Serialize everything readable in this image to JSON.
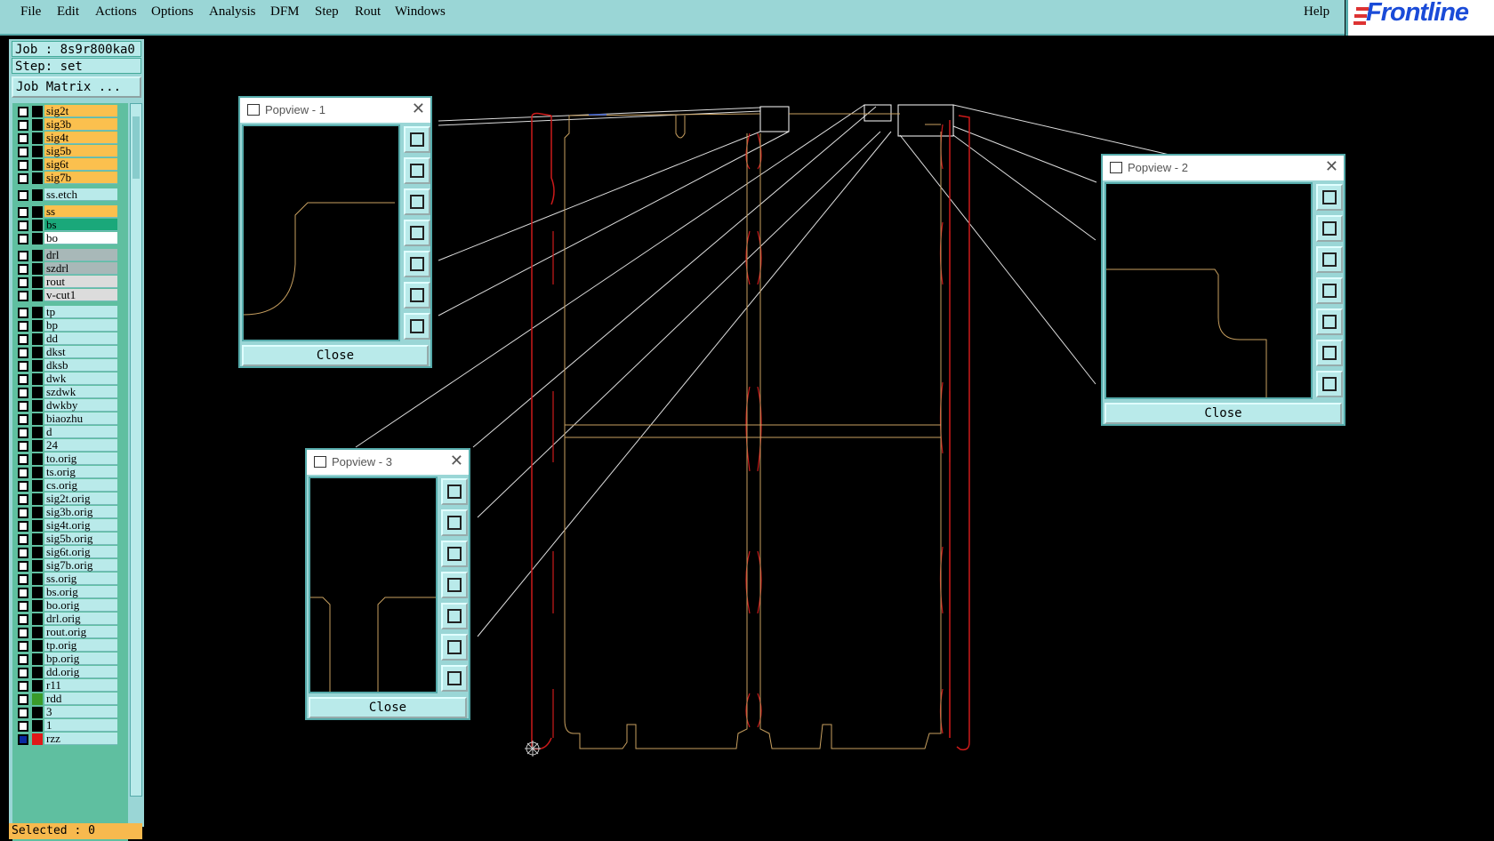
{
  "menubar": {
    "items": [
      "File",
      "Edit",
      "Actions",
      "Options",
      "Analysis",
      "DFM",
      "Step",
      "Rout",
      "Windows"
    ],
    "help": "Help",
    "logo": "Frontline"
  },
  "panel": {
    "job": "Job : 8s9r800ka0",
    "step": "Step: set",
    "job_matrix": "Job Matrix ...",
    "selected": "Selected : 0"
  },
  "layers": [
    {
      "name": "sig2t",
      "color": "#fbc04e"
    },
    {
      "name": "sig3b",
      "color": "#fbc04e"
    },
    {
      "name": "sig4t",
      "color": "#fbc04e"
    },
    {
      "name": "sig5b",
      "color": "#fbc04e"
    },
    {
      "name": "sig6t",
      "color": "#fbc04e"
    },
    {
      "name": "sig7b",
      "color": "#fbc04e"
    },
    {
      "name": "ss.etch",
      "color": "#b9eaea"
    },
    {
      "name": "ss",
      "color": "#fbc04e"
    },
    {
      "name": "bs",
      "color": "#1aa87a"
    },
    {
      "name": "bo",
      "color": "#ffffff"
    },
    {
      "name": "drl",
      "color": "#a8b8b8"
    },
    {
      "name": "szdrl",
      "color": "#a8b8b8"
    },
    {
      "name": "rout",
      "color": "#dcdcdc"
    },
    {
      "name": "v-cut1",
      "color": "#dcdcdc"
    },
    {
      "name": "tp",
      "color": "#b9eaea"
    },
    {
      "name": "bp",
      "color": "#b9eaea"
    },
    {
      "name": "dd",
      "color": "#b9eaea"
    },
    {
      "name": "dkst",
      "color": "#b9eaea"
    },
    {
      "name": "dksb",
      "color": "#b9eaea"
    },
    {
      "name": "dwk",
      "color": "#b9eaea"
    },
    {
      "name": "szdwk",
      "color": "#b9eaea"
    },
    {
      "name": "dwkby",
      "color": "#b9eaea"
    },
    {
      "name": "biaozhu",
      "color": "#b9eaea"
    },
    {
      "name": "d",
      "color": "#b9eaea"
    },
    {
      "name": "24",
      "color": "#b9eaea"
    },
    {
      "name": "to.orig",
      "color": "#b9eaea"
    },
    {
      "name": "ts.orig",
      "color": "#b9eaea"
    },
    {
      "name": "cs.orig",
      "color": "#b9eaea"
    },
    {
      "name": "sig2t.orig",
      "color": "#b9eaea"
    },
    {
      "name": "sig3b.orig",
      "color": "#b9eaea"
    },
    {
      "name": "sig4t.orig",
      "color": "#b9eaea"
    },
    {
      "name": "sig5b.orig",
      "color": "#b9eaea"
    },
    {
      "name": "sig6t.orig",
      "color": "#b9eaea"
    },
    {
      "name": "sig7b.orig",
      "color": "#b9eaea"
    },
    {
      "name": "ss.orig",
      "color": "#b9eaea"
    },
    {
      "name": "bs.orig",
      "color": "#b9eaea"
    },
    {
      "name": "bo.orig",
      "color": "#b9eaea"
    },
    {
      "name": "drl.orig",
      "color": "#b9eaea"
    },
    {
      "name": "rout.orig",
      "color": "#b9eaea"
    },
    {
      "name": "tp.orig",
      "color": "#b9eaea"
    },
    {
      "name": "bp.orig",
      "color": "#b9eaea"
    },
    {
      "name": "dd.orig",
      "color": "#b9eaea"
    },
    {
      "name": "r11",
      "color": "#b9eaea"
    },
    {
      "name": "rdd",
      "color": "#b9eaea"
    },
    {
      "name": "3",
      "color": "#b9eaea"
    },
    {
      "name": "1",
      "color": "#b9eaea"
    },
    {
      "name": "rzz",
      "color": "#b9eaea"
    }
  ],
  "popviews": [
    {
      "title": "Popview - 1",
      "close": "Close"
    },
    {
      "title": "Popview - 2",
      "close": "Close"
    },
    {
      "title": "Popview - 3",
      "close": "Close"
    }
  ]
}
